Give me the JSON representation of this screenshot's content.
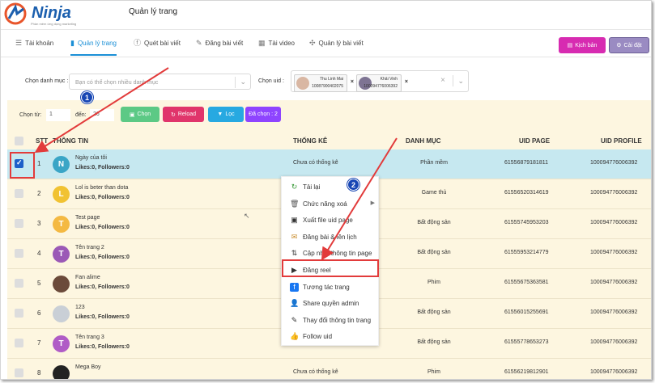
{
  "app": {
    "brand": "Ninja",
    "tagline": "Phần mềm ứng dụng marketing",
    "page_title": "Quản lý trang"
  },
  "nav": {
    "tabs": [
      {
        "label": "Tài khoản",
        "icon": "list-icon"
      },
      {
        "label": "Quản lý trang",
        "icon": "file-icon",
        "active": true
      },
      {
        "label": "Quét bài viết",
        "icon": "facebook-icon"
      },
      {
        "label": "Đăng bài viết",
        "icon": "edit-icon"
      },
      {
        "label": "Tài video",
        "icon": "video-icon"
      },
      {
        "label": "Quản lý bài viết",
        "icon": "puzzle-icon"
      }
    ],
    "script_button": "Kịch bản",
    "settings_button": "Cài đặt"
  },
  "filters": {
    "category_label": "Chọn danh mục :",
    "category_placeholder": "Bạn có thể chọn nhiều danh mục",
    "uid_label": "Chọn uid :",
    "uids": [
      {
        "name": "Thu Linh Mai",
        "id": "10087900402075"
      },
      {
        "name": "Khải Vinh",
        "id": "100094776006392"
      }
    ]
  },
  "toolbar": {
    "from_label": "Chọn từ:",
    "from_value": "1",
    "to_label": "đến:",
    "to_value": "26",
    "choose": "Chọn",
    "reload": "Reload",
    "filter": "Lọc",
    "selected": "Đã chọn : 2"
  },
  "table": {
    "headers": {
      "stt": "STT",
      "info": "THÔNG TIN",
      "stats": "THỐNG KÊ",
      "category": "DANH MỤC",
      "uid_page": "UID PAGE",
      "uid_profile": "UID PROFILE"
    },
    "rows": [
      {
        "stt": "1",
        "name": "Ngày của tôi",
        "letter": "N",
        "color": "#3aa5c6",
        "likes": "Likes:0, Followers:0",
        "stats": "Chưa có thống kê",
        "category": "Phần mềm",
        "uid_page": "61556879181811",
        "uid_profile": "100094776006392",
        "selected": true
      },
      {
        "stt": "2",
        "name": "Lol is beter than dota",
        "letter": "L",
        "color": "#f1c232",
        "likes": "Likes:0, Followers:0",
        "stats": "",
        "category": "Game thủ",
        "uid_page": "61556520314619",
        "uid_profile": "100094776006392"
      },
      {
        "stt": "3",
        "name": "Test page",
        "letter": "T",
        "color": "#f4b942",
        "likes": "Likes:0, Followers:0",
        "stats": "",
        "category": "Bất động sản",
        "uid_page": "61555745953203",
        "uid_profile": "100094776006392"
      },
      {
        "stt": "4",
        "name": "Tên trang 2",
        "letter": "T",
        "color": "#9b59b6",
        "likes": "Likes:0, Followers:0",
        "stats": "",
        "category": "Bất động sản",
        "uid_page": "61555953214779",
        "uid_profile": "100094776006392"
      },
      {
        "stt": "5",
        "name": "Fan alime",
        "letter": "",
        "color": "#6b4a3a",
        "likes": "Likes:0, Followers:0",
        "stats": "",
        "category": "Phim",
        "uid_page": "61555675363581",
        "uid_profile": "100094776006392"
      },
      {
        "stt": "6",
        "name": "123",
        "letter": "",
        "color": "#c9cfd6",
        "likes": "Likes:0, Followers:0",
        "stats": "",
        "category": "Bất động sản",
        "uid_page": "61556015255691",
        "uid_profile": "100094776006392"
      },
      {
        "stt": "7",
        "name": "Tên trang 3",
        "letter": "T",
        "color": "#b05cc6",
        "likes": "Likes:0, Followers:0",
        "stats": "Chưa có thống kê",
        "category": "Bất động sản",
        "uid_page": "61555778653273",
        "uid_profile": "100094776006392"
      },
      {
        "stt": "8",
        "name": "Mega Boy",
        "letter": "",
        "color": "#222",
        "likes": "",
        "stats": "Chưa có thống kê",
        "category": "Phim",
        "uid_page": "61556219812901",
        "uid_profile": "100094776006392"
      }
    ]
  },
  "context_menu": {
    "items": [
      {
        "label": "Tải lại",
        "icon": "refresh-icon"
      },
      {
        "label": "Chức năng xoá",
        "icon": "trash-icon",
        "submenu": true
      },
      {
        "label": "Xuất file uid page",
        "icon": "export-icon"
      },
      {
        "label": "Đăng bài & lên lịch",
        "icon": "schedule-icon"
      },
      {
        "label": "Cập nhật thông tin page",
        "icon": "update-icon"
      },
      {
        "label": "Đăng reel",
        "icon": "reel-icon"
      },
      {
        "label": "Tương tác trang",
        "icon": "facebook-icon"
      },
      {
        "label": "Share quyền admin",
        "icon": "admin-icon"
      },
      {
        "label": "Thay đổi thông tin trang",
        "icon": "info-icon"
      },
      {
        "label": "Follow uid",
        "icon": "like-icon"
      }
    ]
  },
  "annotations": {
    "step1": "1",
    "step2": "2"
  },
  "colors": {
    "accent": "#1a8fd6",
    "script": "#d72bb1",
    "settings": "#9a8bc2",
    "choose": "#5cc985",
    "reload": "#e0356b",
    "filter": "#27a9e1",
    "selected": "#8e44ff",
    "annotation": "#e23b3b"
  }
}
